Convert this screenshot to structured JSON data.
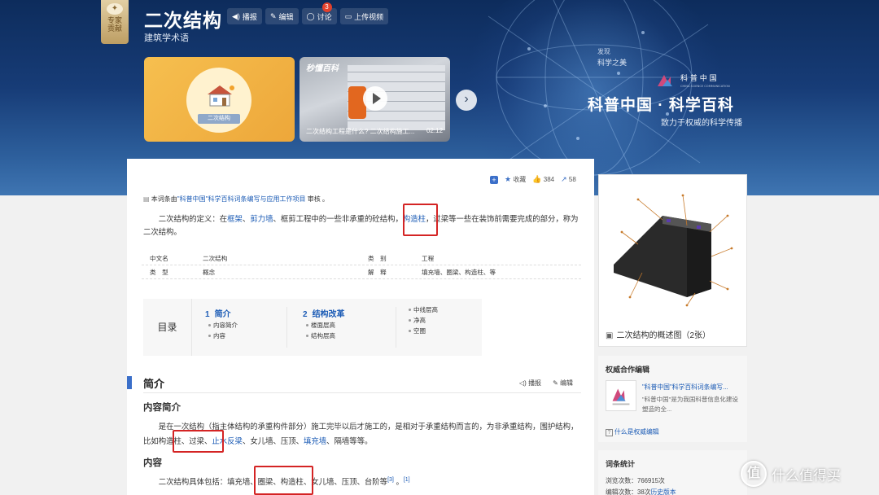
{
  "header": {
    "title": "二次结构",
    "subtitle": "建筑学术语",
    "expert_badge": [
      "专家",
      "贡献"
    ],
    "buttons": {
      "play": "播报",
      "edit": "编辑",
      "discuss": "讨论",
      "discuss_count": "3",
      "upload": "上传视频"
    },
    "card1_label": "二次结构",
    "video": {
      "logo": "秒懂百科",
      "caption": "二次结构工程是什么? 二次结构施工...",
      "duration": "02:12"
    },
    "next_symbol": "›",
    "discover": "发现",
    "discover_sub": "科学之美",
    "logo_text": "科 普 中 国",
    "logo_en": "CHINA SCIENCE COMMUNICATION",
    "brand_title": "科普中国 · 科学百科",
    "brand_sub": "致力于权威的科学传播"
  },
  "actions": {
    "favorite": "收藏",
    "likes": "384",
    "shares": "58"
  },
  "review": {
    "prefix": "本词条由",
    "org": "\"科普中国\"科学百科词条编写与应用工作项目",
    "suffix": " 审核 。"
  },
  "definition": {
    "t1": "二次结构的定义：在",
    "l1": "框架",
    "t2": "、",
    "l2": "剪力墙",
    "t3": "、框剪工程中的一些非承重的砼结构，",
    "l3": "构造柱",
    "t4": "，过梁等一些在装饰前需要完成的部分，称为二次结构。"
  },
  "attributes": [
    {
      "k1": "中文名",
      "v1": "二次结构",
      "k2": "类　别",
      "v2": "工程"
    },
    {
      "k1": "类　型",
      "v1": "概念",
      "k2": "解　释",
      "v2": "填充墙、圈梁、构造柱、等"
    }
  ],
  "toc": {
    "title": "目录",
    "s1_num": "1",
    "s1_title": "简介",
    "s1_items": [
      "内容简介",
      "内容"
    ],
    "s2_num": "2",
    "s2_title": "结构改革",
    "s2_items": [
      "楼面层高",
      "结构层高"
    ],
    "s3_items": [
      "中线层高",
      "净高",
      "空圈"
    ]
  },
  "section": {
    "title": "简介",
    "play": "播报",
    "edit": "编辑"
  },
  "intro": {
    "h": "内容简介",
    "t1": "是在一次结构（指主体结构的承重构件部分）施工完毕以后才施工的，是相对于承重结构而言的，为非承重结构，围护结构，比如",
    "t2": "构造柱、过梁",
    "t3": "、",
    "l1": "止水反梁",
    "t4": "、女儿墙、压顶、",
    "l2": "填充墙",
    "t5": "、隔墙等等。"
  },
  "content": {
    "h": "内容",
    "t1": "二次结构具体包括：填充墙、",
    "t2": "圈梁、构造柱",
    "t3": "、女儿墙、压顶、台阶等",
    "ref1": "[3]",
    "t4": " 。",
    "ref2": "[1]"
  },
  "sidebar": {
    "image_caption": "二次结构的概述图（2张）",
    "authority_title": "权威合作编辑",
    "org_name": "\"科普中国\"科学百科词条编写...",
    "org_desc": "\"科普中国\"是为我国科普信息化建设塑造的全...",
    "what_is": "什么是权威编辑",
    "stats_title": "词条统计",
    "views_label": "浏览次数：",
    "views": "766915次",
    "edits_label": "编辑次数：",
    "edits": "38次",
    "history": "历史版本"
  },
  "watermark": {
    "icon": "值",
    "text": "什么值得买"
  }
}
